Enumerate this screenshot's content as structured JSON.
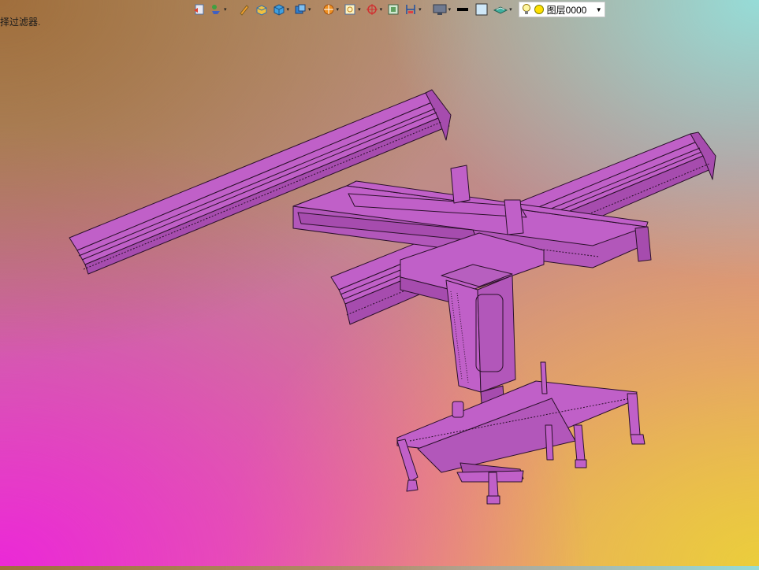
{
  "status": {
    "hint": "择过滤器."
  },
  "toolbar": {
    "buttons": [
      {
        "icon": "layer-previous-icon",
        "dropdown": false
      },
      {
        "icon": "layer-isolate-icon",
        "dropdown": true
      },
      {
        "icon": "pencil-edit-icon",
        "dropdown": false
      },
      {
        "icon": "box-solid-icon",
        "dropdown": false
      },
      {
        "icon": "cube-3d-icon",
        "dropdown": true
      },
      {
        "icon": "view-cube-icon",
        "dropdown": true
      },
      {
        "icon": "render-sphere-icon",
        "dropdown": true
      },
      {
        "icon": "zoom-window-icon",
        "dropdown": true
      },
      {
        "icon": "orbit-icon",
        "dropdown": true
      },
      {
        "icon": "viewport-icon",
        "dropdown": false
      },
      {
        "icon": "dimension-icon",
        "dropdown": true
      },
      {
        "icon": "monitor-icon",
        "dropdown": true
      },
      {
        "icon": "lineweight-icon",
        "dropdown": false
      },
      {
        "icon": "color-swatch-icon",
        "dropdown": false
      },
      {
        "icon": "visual-style-icon",
        "dropdown": true
      }
    ],
    "layer": {
      "name": "图层0000",
      "state_icons": [
        "lightbulb-icon",
        "sun-icon"
      ],
      "colors": {
        "bulb": "#f0d000",
        "sun": "#ffe000"
      }
    }
  },
  "viewport": {
    "model_color": "#c060c8",
    "edge_color": "#2a102a"
  }
}
